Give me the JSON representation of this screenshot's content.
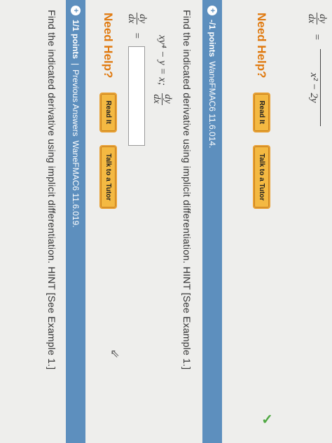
{
  "previous": {
    "deriv_num": "dy",
    "deriv_den": "dx",
    "equals": "=",
    "result_den": "x² − 2y",
    "need_help": "Need Help?",
    "read_it": "Read It",
    "talk_to_tutor": "Talk to a Tutor"
  },
  "question1": {
    "points": "-/1 points",
    "source": "WaneFMAC6 11.6.014.",
    "prompt": "Find the indicated derivative using implicit differentiation. HINT [See Example 1.]",
    "equation": "xy⁴ − y = x;",
    "deriv_num": "dy",
    "deriv_den": "dx",
    "equals": "=",
    "answer_value": "",
    "need_help": "Need Help?",
    "read_it": "Read It",
    "talk_to_tutor": "Talk to a Tutor"
  },
  "question2": {
    "points": "1/1 points",
    "separator": "|",
    "previous_answers": "Previous Answers",
    "source": "WaneFMAC6 11.6.019.",
    "prompt": "Find the indicated derivative using implicit differentiation. HINT [See Example 1.]"
  },
  "colors": {
    "bar": "#5d8fbe",
    "help": "#e07a10",
    "button": "#f4b942",
    "check": "#4fa842"
  }
}
